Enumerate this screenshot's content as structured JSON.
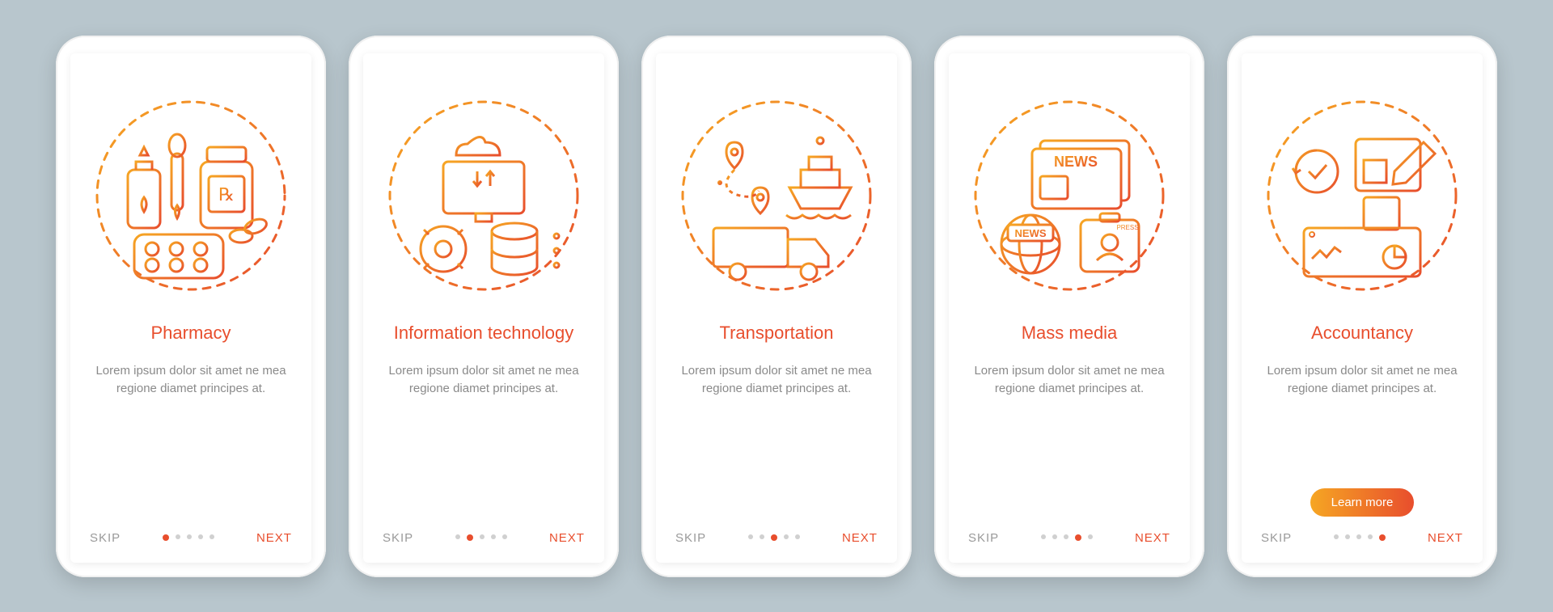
{
  "colors": {
    "accent": "#e84e2d",
    "accent2": "#f6a623",
    "muted": "#8a8a8a"
  },
  "screens": [
    {
      "icon": "pharmacy-icon",
      "title": "Pharmacy",
      "desc": "Lorem ipsum dolor sit amet ne mea regione diamet principes at.",
      "skip": "SKIP",
      "next": "NEXT",
      "active_dot": 0,
      "cta": null
    },
    {
      "icon": "it-icon",
      "title": "Information technology",
      "desc": "Lorem ipsum dolor sit amet ne mea regione diamet principes at.",
      "skip": "SKIP",
      "next": "NEXT",
      "active_dot": 1,
      "cta": null
    },
    {
      "icon": "transport-icon",
      "title": "Transportation",
      "desc": "Lorem ipsum dolor sit amet ne mea regione diamet principes at.",
      "skip": "SKIP",
      "next": "NEXT",
      "active_dot": 2,
      "cta": null
    },
    {
      "icon": "media-icon",
      "title": "Mass media",
      "desc": "Lorem ipsum dolor sit amet ne mea regione diamet principes at.",
      "skip": "SKIP",
      "next": "NEXT",
      "active_dot": 3,
      "cta": null
    },
    {
      "icon": "accountancy-icon",
      "title": "Accountancy",
      "desc": "Lorem ipsum dolor sit amet ne mea regione diamet principes at.",
      "skip": "SKIP",
      "next": "NEXT",
      "active_dot": 4,
      "cta": "Learn more"
    }
  ]
}
